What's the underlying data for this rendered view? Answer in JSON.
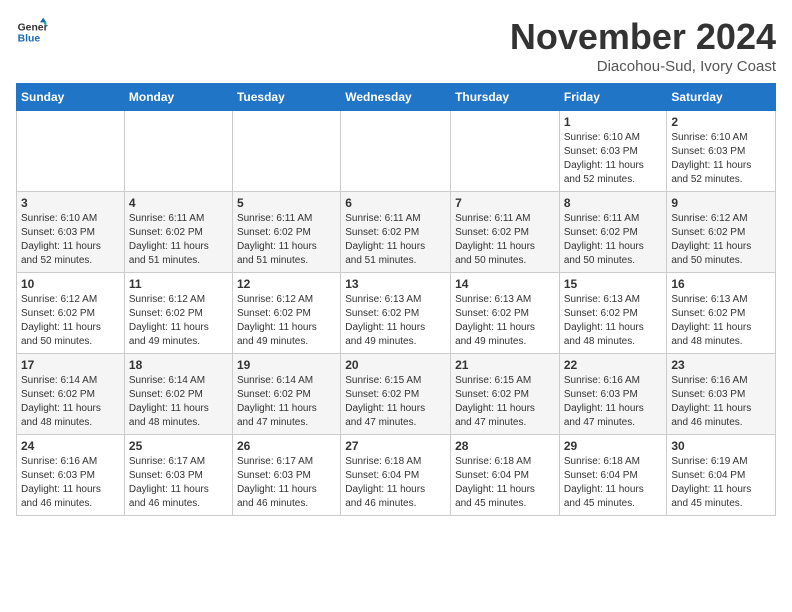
{
  "header": {
    "logo_line1": "General",
    "logo_line2": "Blue",
    "month": "November 2024",
    "location": "Diacohou-Sud, Ivory Coast"
  },
  "days_of_week": [
    "Sunday",
    "Monday",
    "Tuesday",
    "Wednesday",
    "Thursday",
    "Friday",
    "Saturday"
  ],
  "weeks": [
    [
      {
        "num": "",
        "info": ""
      },
      {
        "num": "",
        "info": ""
      },
      {
        "num": "",
        "info": ""
      },
      {
        "num": "",
        "info": ""
      },
      {
        "num": "",
        "info": ""
      },
      {
        "num": "1",
        "info": "Sunrise: 6:10 AM\nSunset: 6:03 PM\nDaylight: 11 hours\nand 52 minutes."
      },
      {
        "num": "2",
        "info": "Sunrise: 6:10 AM\nSunset: 6:03 PM\nDaylight: 11 hours\nand 52 minutes."
      }
    ],
    [
      {
        "num": "3",
        "info": "Sunrise: 6:10 AM\nSunset: 6:03 PM\nDaylight: 11 hours\nand 52 minutes."
      },
      {
        "num": "4",
        "info": "Sunrise: 6:11 AM\nSunset: 6:02 PM\nDaylight: 11 hours\nand 51 minutes."
      },
      {
        "num": "5",
        "info": "Sunrise: 6:11 AM\nSunset: 6:02 PM\nDaylight: 11 hours\nand 51 minutes."
      },
      {
        "num": "6",
        "info": "Sunrise: 6:11 AM\nSunset: 6:02 PM\nDaylight: 11 hours\nand 51 minutes."
      },
      {
        "num": "7",
        "info": "Sunrise: 6:11 AM\nSunset: 6:02 PM\nDaylight: 11 hours\nand 50 minutes."
      },
      {
        "num": "8",
        "info": "Sunrise: 6:11 AM\nSunset: 6:02 PM\nDaylight: 11 hours\nand 50 minutes."
      },
      {
        "num": "9",
        "info": "Sunrise: 6:12 AM\nSunset: 6:02 PM\nDaylight: 11 hours\nand 50 minutes."
      }
    ],
    [
      {
        "num": "10",
        "info": "Sunrise: 6:12 AM\nSunset: 6:02 PM\nDaylight: 11 hours\nand 50 minutes."
      },
      {
        "num": "11",
        "info": "Sunrise: 6:12 AM\nSunset: 6:02 PM\nDaylight: 11 hours\nand 49 minutes."
      },
      {
        "num": "12",
        "info": "Sunrise: 6:12 AM\nSunset: 6:02 PM\nDaylight: 11 hours\nand 49 minutes."
      },
      {
        "num": "13",
        "info": "Sunrise: 6:13 AM\nSunset: 6:02 PM\nDaylight: 11 hours\nand 49 minutes."
      },
      {
        "num": "14",
        "info": "Sunrise: 6:13 AM\nSunset: 6:02 PM\nDaylight: 11 hours\nand 49 minutes."
      },
      {
        "num": "15",
        "info": "Sunrise: 6:13 AM\nSunset: 6:02 PM\nDaylight: 11 hours\nand 48 minutes."
      },
      {
        "num": "16",
        "info": "Sunrise: 6:13 AM\nSunset: 6:02 PM\nDaylight: 11 hours\nand 48 minutes."
      }
    ],
    [
      {
        "num": "17",
        "info": "Sunrise: 6:14 AM\nSunset: 6:02 PM\nDaylight: 11 hours\nand 48 minutes."
      },
      {
        "num": "18",
        "info": "Sunrise: 6:14 AM\nSunset: 6:02 PM\nDaylight: 11 hours\nand 48 minutes."
      },
      {
        "num": "19",
        "info": "Sunrise: 6:14 AM\nSunset: 6:02 PM\nDaylight: 11 hours\nand 47 minutes."
      },
      {
        "num": "20",
        "info": "Sunrise: 6:15 AM\nSunset: 6:02 PM\nDaylight: 11 hours\nand 47 minutes."
      },
      {
        "num": "21",
        "info": "Sunrise: 6:15 AM\nSunset: 6:02 PM\nDaylight: 11 hours\nand 47 minutes."
      },
      {
        "num": "22",
        "info": "Sunrise: 6:16 AM\nSunset: 6:03 PM\nDaylight: 11 hours\nand 47 minutes."
      },
      {
        "num": "23",
        "info": "Sunrise: 6:16 AM\nSunset: 6:03 PM\nDaylight: 11 hours\nand 46 minutes."
      }
    ],
    [
      {
        "num": "24",
        "info": "Sunrise: 6:16 AM\nSunset: 6:03 PM\nDaylight: 11 hours\nand 46 minutes."
      },
      {
        "num": "25",
        "info": "Sunrise: 6:17 AM\nSunset: 6:03 PM\nDaylight: 11 hours\nand 46 minutes."
      },
      {
        "num": "26",
        "info": "Sunrise: 6:17 AM\nSunset: 6:03 PM\nDaylight: 11 hours\nand 46 minutes."
      },
      {
        "num": "27",
        "info": "Sunrise: 6:18 AM\nSunset: 6:04 PM\nDaylight: 11 hours\nand 46 minutes."
      },
      {
        "num": "28",
        "info": "Sunrise: 6:18 AM\nSunset: 6:04 PM\nDaylight: 11 hours\nand 45 minutes."
      },
      {
        "num": "29",
        "info": "Sunrise: 6:18 AM\nSunset: 6:04 PM\nDaylight: 11 hours\nand 45 minutes."
      },
      {
        "num": "30",
        "info": "Sunrise: 6:19 AM\nSunset: 6:04 PM\nDaylight: 11 hours\nand 45 minutes."
      }
    ]
  ]
}
